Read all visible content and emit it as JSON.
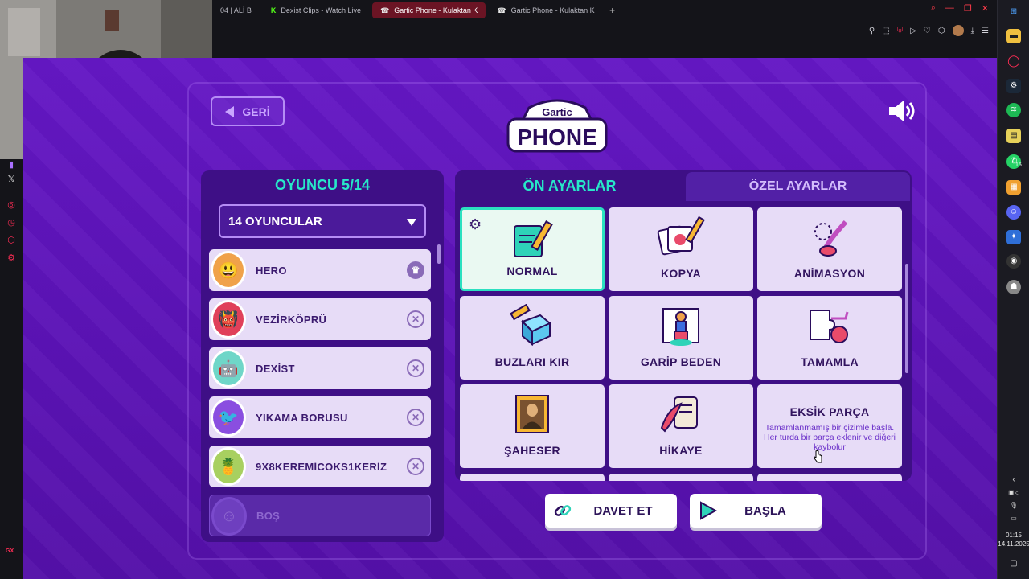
{
  "browser": {
    "tabs": [
      {
        "label": "04 | ALİ B",
        "icon": ""
      },
      {
        "label": "Dexist Clips - Watch Live",
        "icon": "K"
      },
      {
        "label": "Gartic Phone - Kulaktan K",
        "icon": "☎",
        "active": true
      },
      {
        "label": "Gartic Phone - Kulaktan K",
        "icon": "☎"
      }
    ],
    "new_tab": "+",
    "gx_label": "GX"
  },
  "taskbar": {
    "badge_count": "15",
    "time": "01:15",
    "date": "14.11.2025"
  },
  "game": {
    "back_label": "GERİ",
    "logo_top": "Gartic",
    "logo_main": "PHONE",
    "players_title": "OYUNCU 5/14",
    "players_select": "14 OYUNCULAR",
    "players": [
      {
        "name": "HERO",
        "action": "crown"
      },
      {
        "name": "VEZİRKÖPRÜ",
        "action": "remove"
      },
      {
        "name": "DEXİST",
        "action": "remove"
      },
      {
        "name": "YIKAMA BORUSU",
        "action": "remove"
      },
      {
        "name": "9X8KEREMİCOKS1KERİZ",
        "action": "remove"
      }
    ],
    "empty_slot": "BOŞ",
    "tab_presets": "ÖN AYARLAR",
    "tab_custom": "ÖZEL AYARLAR",
    "modes": [
      {
        "label": "NORMAL",
        "selected": true
      },
      {
        "label": "KOPYA"
      },
      {
        "label": "ANİMASYON"
      },
      {
        "label": "BUZLARI KIR"
      },
      {
        "label": "GARİP BEDEN"
      },
      {
        "label": "TAMAMLA"
      },
      {
        "label": "ŞAHESER"
      },
      {
        "label": "HİKAYE"
      },
      {
        "label": "EKSİK PARÇA",
        "description": "Tamamlanmamış bir çizimle başla. Her turda bir parça eklenir ve diğeri kaybolur"
      }
    ],
    "invite_label": "DAVET ET",
    "start_label": "BAŞLA"
  },
  "colors": {
    "accent_teal": "#27e8c8",
    "page_purple": "#5a12b4",
    "panel_purple": "#3e0f86"
  }
}
